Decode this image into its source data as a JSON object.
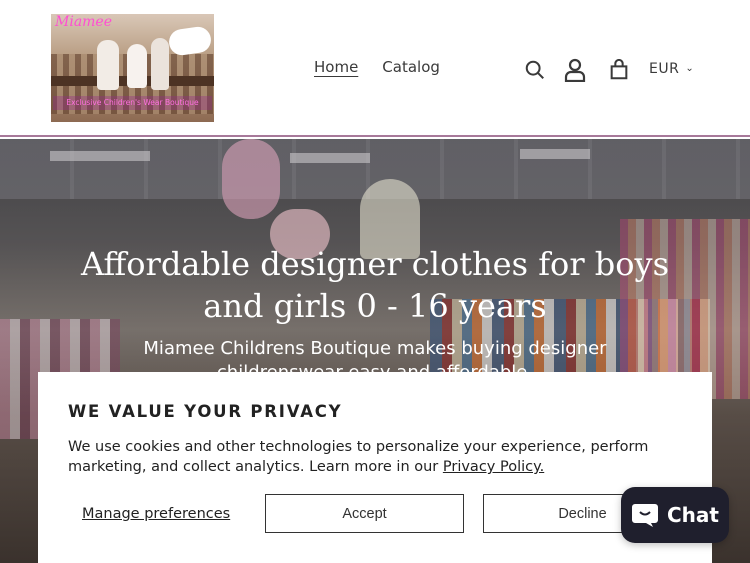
{
  "logo": {
    "brand": "Miamee",
    "tagline": "Exclusive Children's Wear Boutique"
  },
  "nav": {
    "items": [
      {
        "label": "Home",
        "active": true
      },
      {
        "label": "Catalog",
        "active": false
      }
    ]
  },
  "header_icons": [
    "search-icon",
    "account-icon",
    "cart-icon"
  ],
  "currency": {
    "selected": "EUR"
  },
  "hero": {
    "heading": "Affordable designer clothes for boys and girls 0 - 16 years",
    "subheading": "Miamee Childrens Boutique makes buying designer childrenswear easy and affordable."
  },
  "cookie_banner": {
    "title": "WE VALUE YOUR PRIVACY",
    "message": "We use cookies and other technologies to personalize your experience, perform marketing, and collect analytics. Learn more in our ",
    "link_text": "Privacy Policy.",
    "manage_label": "Manage preferences",
    "accept_label": "Accept",
    "decline_label": "Decline"
  },
  "chat": {
    "label": "Chat"
  },
  "colors": {
    "header_border": "#a7799a",
    "chat_bg": "#1f1f2d",
    "logo_text": "#ff4fd2"
  }
}
